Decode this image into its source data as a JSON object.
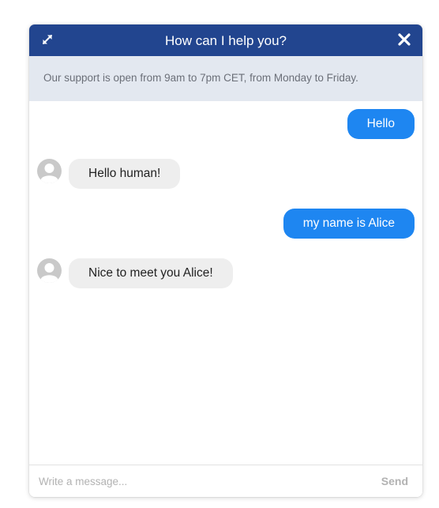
{
  "header": {
    "title": "How can I help you?",
    "expand_icon": "expand-arrows-icon",
    "close_icon": "close-x-icon",
    "background": "#22458f"
  },
  "notice": {
    "text": "Our support is open from 9am to 7pm CET, from Monday to Friday."
  },
  "messages": [
    {
      "from": "user",
      "text": "Hello"
    },
    {
      "from": "bot",
      "text": "Hello human!",
      "avatar": "default-avatar-icon"
    },
    {
      "from": "user",
      "text": "my name is Alice"
    },
    {
      "from": "bot",
      "text": "Nice to meet you Alice!",
      "avatar": "default-avatar-icon"
    }
  ],
  "composer": {
    "placeholder": "Write a message...",
    "value": "",
    "send_label": "Send"
  },
  "colors": {
    "user_bubble": "#1e86f1",
    "bot_bubble": "#eeeeee",
    "notice_background": "#e3e8f0"
  }
}
